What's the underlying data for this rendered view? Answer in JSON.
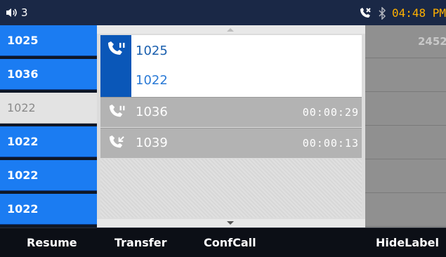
{
  "status_bar": {
    "volume_icon": "speaker-icon",
    "account_index": "3",
    "call_icon": "missed-call-icon",
    "bluetooth_icon": "bluetooth-icon",
    "time": "04:48 PM"
  },
  "line_keys": [
    {
      "label": "1025",
      "state": "active"
    },
    {
      "label": "1036",
      "state": "active"
    },
    {
      "label": "1022",
      "state": "inactive"
    },
    {
      "label": "1022",
      "state": "active"
    },
    {
      "label": "1022",
      "state": "active"
    },
    {
      "label": "1022",
      "state": "active"
    }
  ],
  "calls": {
    "active": {
      "remote": "1025",
      "local": "1022",
      "icon": "handset-talking-icon"
    },
    "held": [
      {
        "number": "1036",
        "duration": "00:00:29",
        "icon": "handset-talking-icon"
      },
      {
        "number": "1039",
        "duration": "00:00:13",
        "icon": "handset-incoming-icon"
      }
    ]
  },
  "right_panel": {
    "lines": [
      "2452",
      "",
      "",
      "",
      "",
      ""
    ]
  },
  "softkeys": [
    "Resume",
    "Transfer",
    "ConfCall",
    "HideLabel"
  ],
  "colors": {
    "line_blue": "#1b7cf2",
    "status_time": "#ffb000",
    "active_call_bg": "#0a57b8"
  }
}
